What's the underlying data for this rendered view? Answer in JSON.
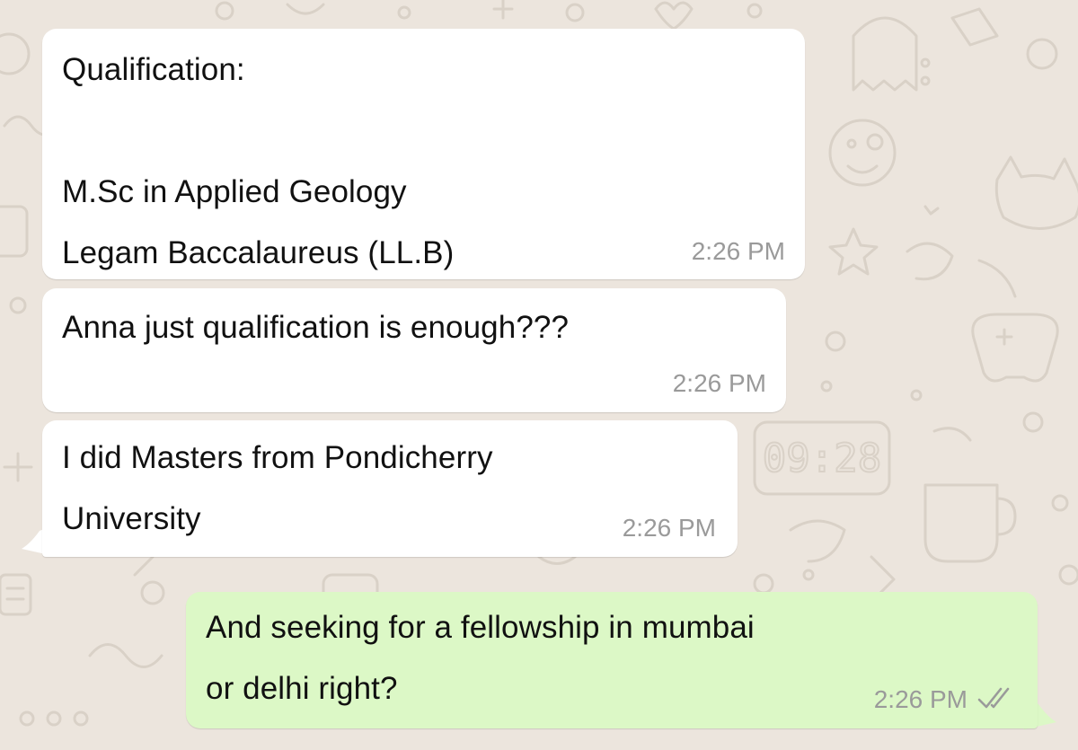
{
  "colors": {
    "wallpaper": "#ece5dd",
    "incoming_bubble": "#ffffff",
    "outgoing_bubble": "#dcf8c6",
    "timestamp": "#9a9a9a",
    "read_ticks": "#9a9a9a"
  },
  "wallpaper": {
    "clock_doodle_text": "09:28"
  },
  "messages": [
    {
      "direction": "incoming",
      "text": "Qualification:\n\nM.Sc in Applied Geology\nLegam Baccalaureus (LL.B)",
      "time": "2:26 PM"
    },
    {
      "direction": "incoming",
      "text": "Anna just qualification is enough???",
      "time": "2:26 PM"
    },
    {
      "direction": "incoming",
      "text": "I did Masters from Pondicherry\nUniversity",
      "time": "2:26 PM"
    },
    {
      "direction": "outgoing",
      "text": "And seeking for a fellowship in mumbai\nor delhi right?",
      "time": "2:26 PM",
      "status_icon": "double-check-icon"
    }
  ]
}
